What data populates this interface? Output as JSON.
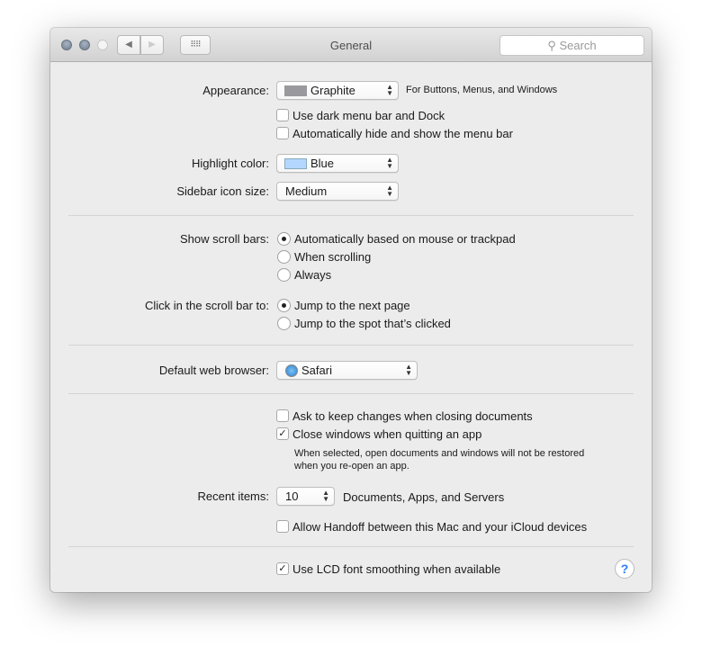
{
  "window": {
    "title": "General",
    "search_placeholder": "Search"
  },
  "appearance": {
    "label": "Appearance:",
    "value": "Graphite",
    "swatch": "#9a9a9e",
    "note": "For Buttons, Menus, and Windows"
  },
  "dark_menu": {
    "label": "Use dark menu bar and Dock",
    "checked": false
  },
  "auto_hide": {
    "label": "Automatically hide and show the menu bar",
    "checked": false
  },
  "highlight": {
    "label": "Highlight color:",
    "value": "Blue",
    "swatch": "#b3d7ff"
  },
  "sidebar_size": {
    "label": "Sidebar icon size:",
    "value": "Medium"
  },
  "scroll_bars": {
    "label": "Show scroll bars:",
    "options": [
      "Automatically based on mouse or trackpad",
      "When scrolling",
      "Always"
    ],
    "selected": 0
  },
  "click_scroll": {
    "label": "Click in the scroll bar to:",
    "options": [
      "Jump to the next page",
      "Jump to the spot that’s clicked"
    ],
    "selected": 0
  },
  "browser": {
    "label": "Default web browser:",
    "value": "Safari"
  },
  "ask_keep": {
    "label": "Ask to keep changes when closing documents",
    "checked": false
  },
  "close_windows": {
    "label": "Close windows when quitting an app",
    "checked": true,
    "note_line1": "When selected, open documents and windows will not be restored",
    "note_line2": "when you re-open an app."
  },
  "recent": {
    "label": "Recent items:",
    "value": "10",
    "suffix": "Documents, Apps, and Servers"
  },
  "handoff": {
    "label": "Allow Handoff between this Mac and your iCloud devices",
    "checked": false
  },
  "lcd": {
    "label": "Use LCD font smoothing when available",
    "checked": true
  },
  "help": "?"
}
